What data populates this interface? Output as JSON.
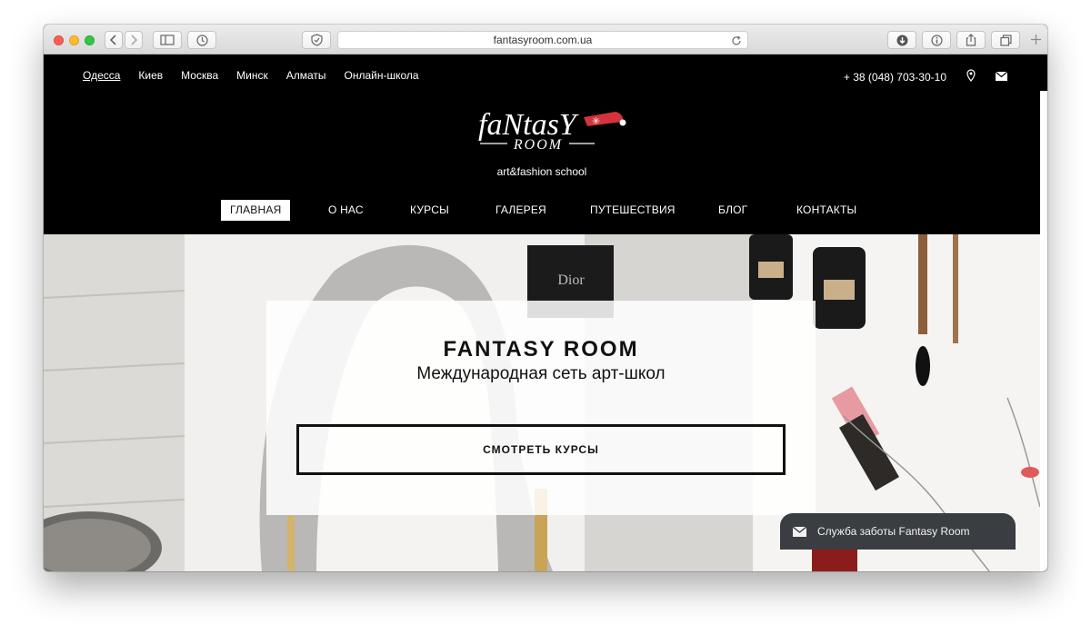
{
  "browser": {
    "url": "fantasyroom.com.ua"
  },
  "header": {
    "cities": [
      "Одесса",
      "Киев",
      "Москва",
      "Минск",
      "Алматы",
      "Онлайн-школа"
    ],
    "phone": "+ 38 (048) 703-30-10",
    "logo_text_top": "faNtasY",
    "logo_text_bottom": "ROOM",
    "tagline": "art&fashion school"
  },
  "nav": {
    "items": [
      "ГЛАВНАЯ",
      "О НАС",
      "КУРСЫ",
      "ГАЛЕРЕЯ",
      "ПУТЕШЕСТВИЯ",
      "БЛОГ",
      "КОНТАКТЫ"
    ],
    "active": "ГЛАВНАЯ"
  },
  "hero": {
    "title": "FANTASY ROOM",
    "subtitle": "Международная сеть арт-школ",
    "cta": "СМОТРЕТЬ КУРСЫ",
    "product_label": "Dior"
  },
  "chat": {
    "label": "Служба заботы Fantasy Room"
  },
  "colors": {
    "site_bg": "#000000",
    "logo_hat": "#d3333a",
    "chat_bg": "#3a3d41"
  }
}
